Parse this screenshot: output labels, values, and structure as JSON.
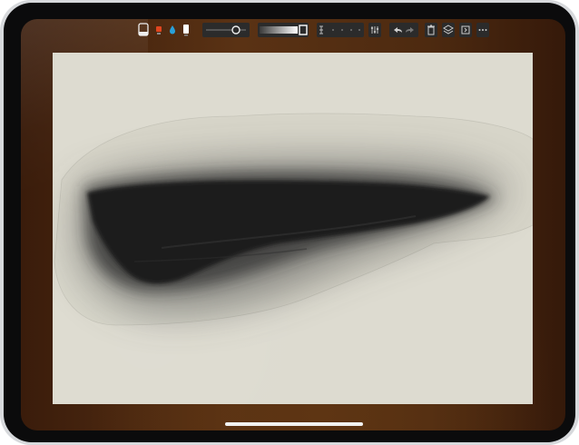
{
  "app": {
    "name": "Painting app",
    "device": "iPad"
  },
  "toolbar": {
    "tools": [
      {
        "name": "brush",
        "icon": "brush-tool-icon"
      },
      {
        "name": "color",
        "icon": "color-swatch-icon",
        "color": "#e0451f"
      },
      {
        "name": "water",
        "icon": "water-drop-icon",
        "color": "#2aa0d8"
      },
      {
        "name": "paper",
        "icon": "paper-tool-icon",
        "color": "#ffffff"
      }
    ],
    "brush_size": {
      "icon": "brush-size-icon",
      "level": 0.75
    },
    "opacity": {
      "icon": "opacity-gradient-icon",
      "level": 1.0
    },
    "icons": [
      "select-tool-icon",
      "grid-dots-icon",
      "adjust-icon",
      "undo-icon",
      "redo-icon",
      "trash-icon",
      "layers-icon",
      "export-icon",
      "more-icon"
    ]
  },
  "canvas": {
    "paper_color": "#dddbd0",
    "stroke_color": "#1b1b1b"
  },
  "colors": {
    "desk": "#4d2a10",
    "bezel": "#0b0b0c",
    "frame": "#d7d9dc"
  }
}
